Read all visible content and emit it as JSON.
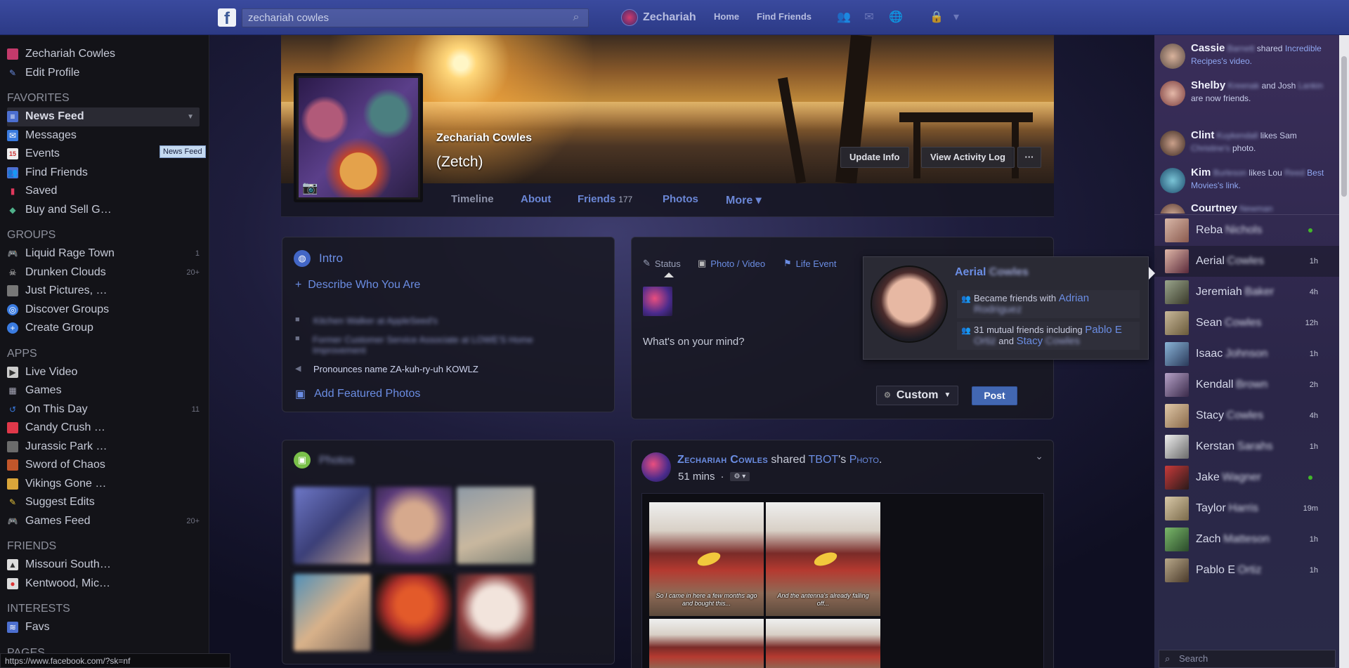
{
  "topbar": {
    "logo": "f",
    "search_value": "zechariah cowles",
    "user_name": "Zechariah",
    "home": "Home",
    "find_friends": "Find Friends"
  },
  "left_sidebar": {
    "profile": "Zechariah Cowles",
    "edit_profile": "Edit Profile",
    "favorites_title": "FAVORITES",
    "favorites": [
      {
        "label": "News Feed",
        "count": "",
        "icon": "news-feed-icon"
      },
      {
        "label": "Messages",
        "count": "",
        "icon": "messages-icon"
      },
      {
        "label": "Events",
        "count": "",
        "icon": "events-icon"
      },
      {
        "label": "Find Friends",
        "count": "",
        "icon": "find-friends-icon"
      },
      {
        "label": "Saved",
        "count": "",
        "icon": "saved-icon"
      },
      {
        "label": "Buy and Sell G…",
        "count": "",
        "icon": "buy-sell-icon"
      }
    ],
    "groups_title": "GROUPS",
    "groups": [
      {
        "label": "Liquid Rage Town",
        "count": "1"
      },
      {
        "label": "Drunken Clouds",
        "count": "20+"
      },
      {
        "label": "Just Pictures, …",
        "count": ""
      },
      {
        "label": "Discover Groups",
        "count": ""
      },
      {
        "label": "Create Group",
        "count": ""
      }
    ],
    "apps_title": "APPS",
    "apps": [
      {
        "label": "Live Video",
        "count": ""
      },
      {
        "label": "Games",
        "count": ""
      },
      {
        "label": "On This Day",
        "count": "11"
      },
      {
        "label": "Candy Crush …",
        "count": ""
      },
      {
        "label": "Jurassic Park …",
        "count": ""
      },
      {
        "label": "Sword of Chaos",
        "count": ""
      },
      {
        "label": "Vikings Gone …",
        "count": ""
      },
      {
        "label": "Suggest Edits",
        "count": ""
      },
      {
        "label": "Games Feed",
        "count": "20+"
      }
    ],
    "friends_title": "FRIENDS",
    "friends": [
      {
        "label": "Missouri South…"
      },
      {
        "label": "Kentwood, Mic…"
      }
    ],
    "interests_title": "INTERESTS",
    "interests": [
      {
        "label": "Favs"
      }
    ],
    "pages_title": "PAGES",
    "tooltip": "News Feed",
    "status_url": "https://www.facebook.com/?sk=nf"
  },
  "profile": {
    "name": "Zechariah Cowles",
    "nickname": "(Zetch)",
    "update_info": "Update Info",
    "view_activity": "View Activity Log",
    "more_dots": "···",
    "tabs": {
      "timeline": "Timeline",
      "about": "About",
      "friends": "Friends",
      "friends_count": "177",
      "photos": "Photos",
      "more": "More ▾"
    }
  },
  "intro": {
    "title": "Intro",
    "describe": "Describe Who You Are",
    "job1": "Kitchen Walker at AppleSeed's",
    "job2": "Former Customer Service Associate at LOWE'S Home Improvement",
    "pronounce": "Pronounces name ZA-kuh-ry-uh KOWLZ",
    "add_photos": "Add Featured Photos"
  },
  "composer": {
    "status": "Status",
    "photo_video": "Photo / Video",
    "life_event": "Life Event",
    "placeholder": "What's on your mind?",
    "privacy": "Custom",
    "post": "Post"
  },
  "hovercard": {
    "name": "Aerial",
    "name_blur": "Cowles",
    "row1_text": "Became friends with",
    "row1_link": "Adrian",
    "row1_link_blur": "Rodriguez",
    "row2_text": "31 mutual friends including",
    "row2_link1": "Pablo E",
    "row2_link1_blur": "Ortiz",
    "row2_and": "and",
    "row2_link2": "Stacy",
    "row2_link2_blur": "Cowles"
  },
  "photos_panel": {
    "title": "Photos"
  },
  "post": {
    "author": "Zechariah Cowles",
    "shared": "shared",
    "source": "TBOT",
    "possessive": "'s",
    "object": "Photo",
    "time": "51 mins",
    "dot": "·",
    "caption1": "So I came in here a few months ago and bought this...",
    "caption2": "And the antenna's already falling off..."
  },
  "right_sidebar": {
    "ticker": [
      {
        "name": "Cassie",
        "blur": "Barnett",
        "text": "shared",
        "link": "Incredible Recipes's video."
      },
      {
        "name": "Shelby",
        "blur": "Kreenak",
        "text": "and Josh",
        "blur2": "Lankin",
        "text2": "are now friends."
      },
      {
        "name": "Clint",
        "blur": "Kuykendall",
        "text": "likes Sam",
        "blur2": "Christine's",
        "text2": "photo."
      },
      {
        "name": "Kim",
        "blur": "Burleson",
        "text": "likes Lou",
        "blur2": "Reed",
        "text2": "Best Movies's link."
      },
      {
        "name": "Courtney",
        "blur": "Newman",
        "text": "",
        "link": ""
      }
    ],
    "chat": [
      {
        "name": "Reba",
        "blur": "Nichols",
        "time": "",
        "online": true
      },
      {
        "name": "Aerial",
        "blur": "Cowles",
        "time": "1h",
        "online": false
      },
      {
        "name": "Jeremiah",
        "blur": "Baker",
        "time": "4h",
        "online": false
      },
      {
        "name": "Sean",
        "blur": "Cowles",
        "time": "12h",
        "online": false
      },
      {
        "name": "Isaac",
        "blur": "Johnson",
        "time": "1h",
        "online": false
      },
      {
        "name": "Kendall",
        "blur": "Brown",
        "time": "2h",
        "online": false
      },
      {
        "name": "Stacy",
        "blur": "Cowles",
        "time": "4h",
        "online": false
      },
      {
        "name": "Kerstan",
        "blur": "Sarahs",
        "time": "1h",
        "online": false
      },
      {
        "name": "Jake",
        "blur": "Wagner",
        "time": "",
        "online": true
      },
      {
        "name": "Taylor",
        "blur": "Harris",
        "time": "19m",
        "online": false
      },
      {
        "name": "Zach",
        "blur": "Matteson",
        "time": "1h",
        "online": false
      },
      {
        "name": "Pablo E",
        "blur": "Ortiz",
        "time": "1h",
        "online": false
      }
    ],
    "search_placeholder": "Search"
  },
  "colors": {
    "topbar": "#3a4a9e",
    "link": "#6b8de3",
    "post_button": "#4267b2",
    "online_dot": "#42b72a"
  }
}
